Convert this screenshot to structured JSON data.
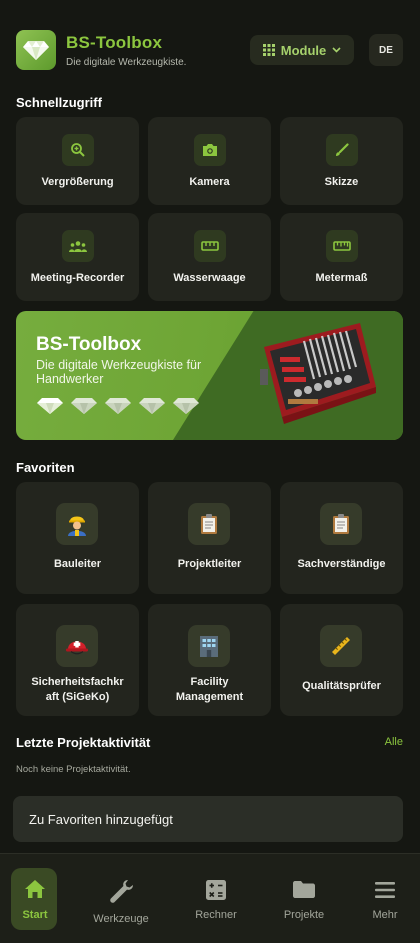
{
  "header": {
    "title": "BS-Toolbox",
    "subtitle": "Die digitale Werkzeugkiste.",
    "module_label": "Module",
    "lang": "DE"
  },
  "quick_access": {
    "title": "Schnellzugriff",
    "items": [
      {
        "label": "Vergrößerung",
        "icon": "zoom-in-icon"
      },
      {
        "label": "Kamera",
        "icon": "camera-icon"
      },
      {
        "label": "Skizze",
        "icon": "brush-icon"
      },
      {
        "label": "Meeting-Recorder",
        "icon": "groups-icon"
      },
      {
        "label": "Wasserwaage",
        "icon": "level-icon"
      },
      {
        "label": "Metermaß",
        "icon": "ruler-icon"
      }
    ]
  },
  "banner": {
    "title": "BS-Toolbox",
    "subtitle": "Die digitale Werkzeugkiste für Handwerker"
  },
  "favorites": {
    "title": "Favoriten",
    "items": [
      {
        "label": "Bauleiter",
        "icon": "construction-worker-icon"
      },
      {
        "label": "Projektleiter",
        "icon": "clipboard-icon"
      },
      {
        "label": "Sachverständige",
        "icon": "clipboard-icon"
      },
      {
        "label": "Sicherheitsfachkraft (SiGeKo)",
        "line1": "Sicherheitsfachkr",
        "line2": "aft (SiGeKo)",
        "icon": "rescue-helmet-icon"
      },
      {
        "label": "Facility Management",
        "line1": "Facility",
        "line2": "Management",
        "icon": "office-building-icon"
      },
      {
        "label": "Qualitätsprüfer",
        "icon": "straight-ruler-icon"
      }
    ]
  },
  "activity": {
    "title": "Letzte Projektaktivität",
    "all_link": "Alle",
    "empty_text": "Noch keine Projektaktivität."
  },
  "toast": {
    "text": "Zu Favoriten hinzugefügt"
  },
  "nav": {
    "items": [
      {
        "label": "Start",
        "icon": "home-icon",
        "active": true
      },
      {
        "label": "Werkzeuge",
        "icon": "wrench-icon"
      },
      {
        "label": "Rechner",
        "icon": "calculator-icon"
      },
      {
        "label": "Projekte",
        "icon": "folder-icon"
      },
      {
        "label": "Mehr",
        "icon": "menu-icon"
      }
    ]
  },
  "colors": {
    "accent": "#8cc63f",
    "background": "#151712",
    "tile": "#23251e",
    "nav_active": "#3a4a24"
  }
}
